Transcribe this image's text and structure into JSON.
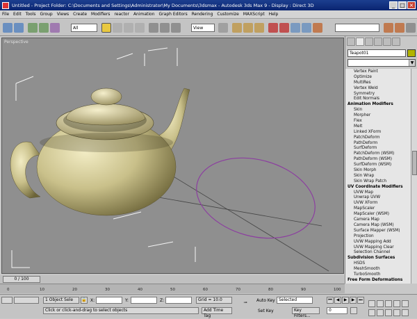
{
  "window": {
    "title": "Untitled - Project Folder: C:\\Documents and Settings\\Administrator\\My Documents\\3dsmax - Autodesk 3ds Max 9 - Display : Direct 3D"
  },
  "menu": [
    "File",
    "Edit",
    "Tools",
    "Group",
    "Views",
    "Create",
    "Modifiers",
    "reactor",
    "Animation",
    "Graph Editors",
    "Rendering",
    "Customize",
    "MAXScript",
    "Help"
  ],
  "toolbar": {
    "selection_filter": "All",
    "coord_system": "View"
  },
  "viewport": {
    "label": "Perspective",
    "watermark": "www.cgjoy.com"
  },
  "command_panel": {
    "object_name": "Teapot01",
    "modifier_list": "",
    "items": [
      {
        "text": "Vertex Paint",
        "header": false
      },
      {
        "text": "Optimize",
        "header": false
      },
      {
        "text": "MultiRes",
        "header": false
      },
      {
        "text": "Vertex Weld",
        "header": false
      },
      {
        "text": "Symmetry",
        "header": false
      },
      {
        "text": "Edit Normals",
        "header": false
      },
      {
        "text": "Animation Modifiers",
        "header": true
      },
      {
        "text": "Skin",
        "header": false
      },
      {
        "text": "Morpher",
        "header": false
      },
      {
        "text": "Flex",
        "header": false
      },
      {
        "text": "Melt",
        "header": false
      },
      {
        "text": "Linked XForm",
        "header": false
      },
      {
        "text": "PatchDeform",
        "header": false
      },
      {
        "text": "PathDeform",
        "header": false
      },
      {
        "text": "SurfDeform",
        "header": false
      },
      {
        "text": "PatchDeform (WSM)",
        "header": false
      },
      {
        "text": "PathDeform (WSM)",
        "header": false
      },
      {
        "text": "SurfDeform (WSM)",
        "header": false
      },
      {
        "text": "Skin Morph",
        "header": false
      },
      {
        "text": "Skin Wrap",
        "header": false
      },
      {
        "text": "Skin Wrap Patch",
        "header": false
      },
      {
        "text": "UV Coordinate Modifiers",
        "header": true
      },
      {
        "text": "UVW Map",
        "header": false
      },
      {
        "text": "Unwrap UVW",
        "header": false
      },
      {
        "text": "UVW XForm",
        "header": false
      },
      {
        "text": "MapScaler",
        "header": false
      },
      {
        "text": "MapScaler (WSM)",
        "header": false
      },
      {
        "text": "Camera Map",
        "header": false
      },
      {
        "text": "Camera Map (WSM)",
        "header": false
      },
      {
        "text": "Surface Mapper (WSM)",
        "header": false
      },
      {
        "text": "Projection",
        "header": false
      },
      {
        "text": "UVW Mapping Add",
        "header": false
      },
      {
        "text": "UVW Mapping Clear",
        "header": false
      },
      {
        "text": "Selection Channel",
        "header": false
      },
      {
        "text": "Subdivision Surfaces",
        "header": true
      },
      {
        "text": "HSDS",
        "header": false
      },
      {
        "text": "MeshSmooth",
        "header": false
      },
      {
        "text": "TurboSmooth",
        "header": false
      },
      {
        "text": "Free Form Deformations",
        "header": true
      }
    ]
  },
  "timeline": {
    "slider": "0 / 100",
    "ticks": [
      "0",
      "10",
      "20",
      "30",
      "40",
      "50",
      "60",
      "70",
      "80",
      "90",
      "100"
    ]
  },
  "status": {
    "selection": "1 Object Sele",
    "prompt": "Click or click-and-drag to select objects",
    "x_label": "X:",
    "y_label": "Y:",
    "z_label": "Z:",
    "grid": "Grid = 10.0",
    "add_time_tag": "Add Time Tag",
    "auto_key": "Auto Key",
    "set_key": "Set Key",
    "key_mode": "Selected",
    "key_filters": "Key Filters...",
    "frame": "0"
  },
  "colors": {
    "viewport_bg": "#8f8f8f",
    "teapot": "#c9c08a",
    "titlebar": "#0a2470"
  }
}
